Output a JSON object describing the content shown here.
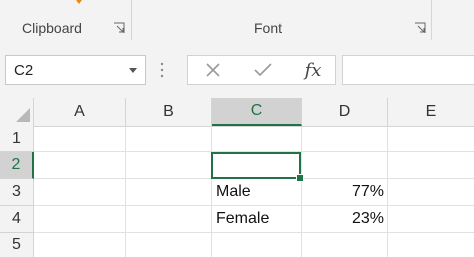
{
  "ribbon": {
    "groups": [
      {
        "label": "Clipboard"
      },
      {
        "label": "Font"
      }
    ]
  },
  "formula_bar": {
    "name_box_value": "C2",
    "cancel_icon": "x-icon",
    "enter_icon": "check-icon",
    "fx_label": "fx",
    "formula_value": ""
  },
  "grid": {
    "columns": [
      "A",
      "B",
      "C",
      "D",
      "E"
    ],
    "rows": [
      "1",
      "2",
      "3",
      "4",
      "5"
    ],
    "selected_cell": "C2",
    "cells": {
      "C3": "Male",
      "D3": "77%",
      "C4": "Female",
      "D4": "23%"
    }
  },
  "colors": {
    "accent": "#217346",
    "ribbon_bg": "#f3f3f3",
    "brand_orange": "#e88a1a"
  }
}
